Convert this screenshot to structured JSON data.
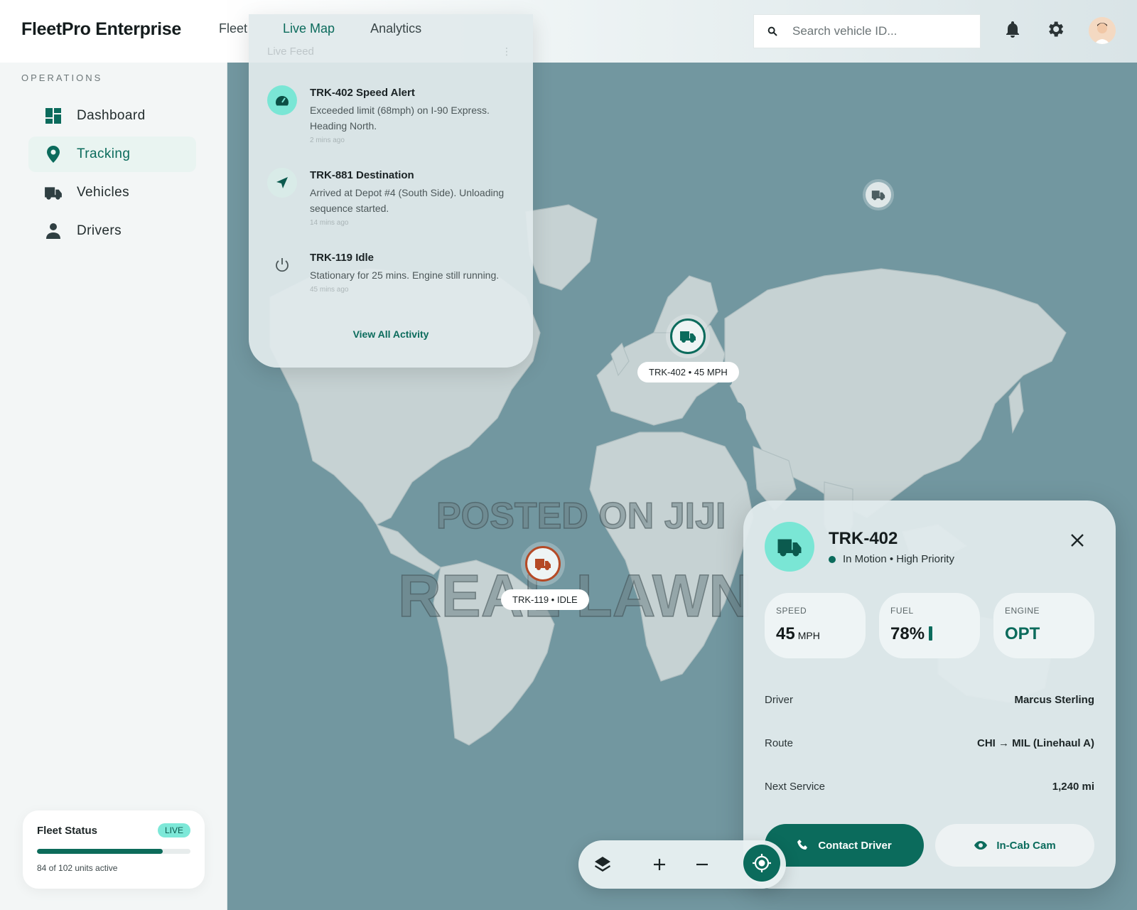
{
  "header": {
    "brand": "FleetPro Enterprise",
    "nav": [
      {
        "label": "Fleet"
      },
      {
        "label": "Live Map"
      },
      {
        "label": "Analytics"
      }
    ],
    "search_placeholder": "Search vehicle ID..."
  },
  "sidebar": {
    "section_label": "OPERATIONS",
    "items": [
      {
        "label": "Dashboard",
        "icon": "dashboard-icon"
      },
      {
        "label": "Tracking",
        "icon": "location-pin-icon"
      },
      {
        "label": "Vehicles",
        "icon": "truck-icon"
      },
      {
        "label": "Drivers",
        "icon": "person-icon"
      }
    ],
    "fleet_status": {
      "title": "Fleet Status",
      "badge": "LIVE",
      "active_units": 84,
      "total_units": 102,
      "progress_fraction": 0.82,
      "summary": "84 of 102 units active"
    }
  },
  "feed": {
    "title": "Live Feed",
    "items": [
      {
        "title": "TRK-402 Speed Alert",
        "text": "Exceeded limit (68mph) on I-90 Express. Heading North.",
        "time": "2 mins ago",
        "icon": "speedometer-icon"
      },
      {
        "title": "TRK-881 Destination",
        "text": "Arrived at Depot #4 (South Side). Unloading sequence started.",
        "time": "14 mins ago",
        "icon": "navigation-arrow-icon"
      },
      {
        "title": "TRK-119 Idle",
        "text": "Stationary for 25 mins. Engine still running.",
        "time": "45 mins ago",
        "icon": "power-icon"
      }
    ],
    "view_all": "View All Activity"
  },
  "map": {
    "markers": [
      {
        "label": "TRK-402 • 45 MPH",
        "color": "#0b6b5c"
      },
      {
        "label": "TRK-119 • IDLE",
        "color": "#b54a26"
      }
    ],
    "watermark_line1": "POSTED ON JIJI",
    "watermark_line2": "REAL LAWN"
  },
  "detail": {
    "vehicle_id": "TRK-402",
    "status": "In Motion",
    "priority": "High Priority",
    "status_line": "In Motion • High Priority",
    "stats": [
      {
        "label": "SPEED",
        "value": "45",
        "unit": "MPH"
      },
      {
        "label": "FUEL",
        "value": "78%"
      },
      {
        "label": "ENGINE",
        "value": "OPT"
      }
    ],
    "rows": [
      {
        "label": "Driver",
        "value": "Marcus Sterling"
      },
      {
        "label": "Route",
        "value": "CHI → MIL (Linehaul A)"
      },
      {
        "label": "Next Service",
        "value": "1,240 mi"
      }
    ],
    "contact_button": "Contact Driver",
    "cam_button": "In-Cab Cam"
  },
  "colors": {
    "accent": "#0b6b5c",
    "accent_light": "#7ae6d5",
    "alert": "#b54a26",
    "map_water": "#7297a0",
    "map_land": "#c7d3d3"
  }
}
